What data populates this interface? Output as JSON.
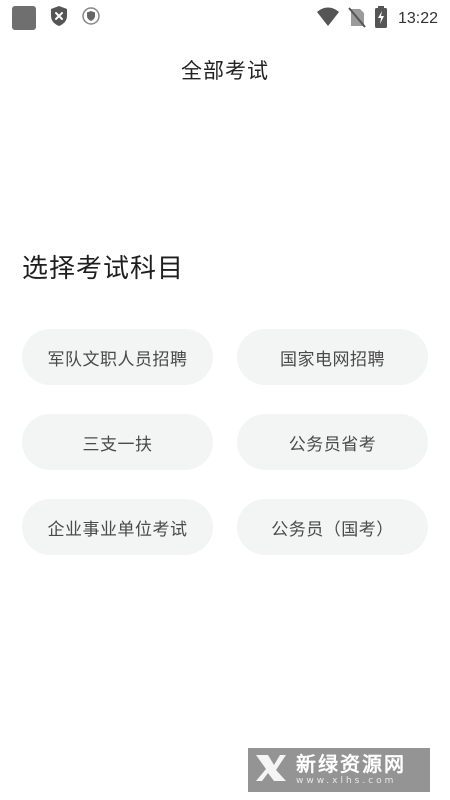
{
  "status_bar": {
    "time": "13:22",
    "icons": [
      "app-square-icon",
      "shield-close-icon",
      "security-shield-icon",
      "wifi-icon",
      "no-sim-icon",
      "battery-charging-icon"
    ]
  },
  "header": {
    "title": "全部考试"
  },
  "section": {
    "title": "选择考试科目"
  },
  "exams": [
    {
      "label": "军队文职人员招聘"
    },
    {
      "label": "国家电网招聘"
    },
    {
      "label": "三支一扶"
    },
    {
      "label": "公务员省考"
    },
    {
      "label": "企业事业单位考试"
    },
    {
      "label": "公务员（国考）"
    }
  ],
  "watermark": {
    "name": "新绿资源网",
    "url": "www.xlhs.com"
  },
  "colors": {
    "button_bg": "#f3f4f4",
    "button_text": "#4a4a4a",
    "title_text": "#1e1e1e",
    "status_icon": "#555555"
  }
}
